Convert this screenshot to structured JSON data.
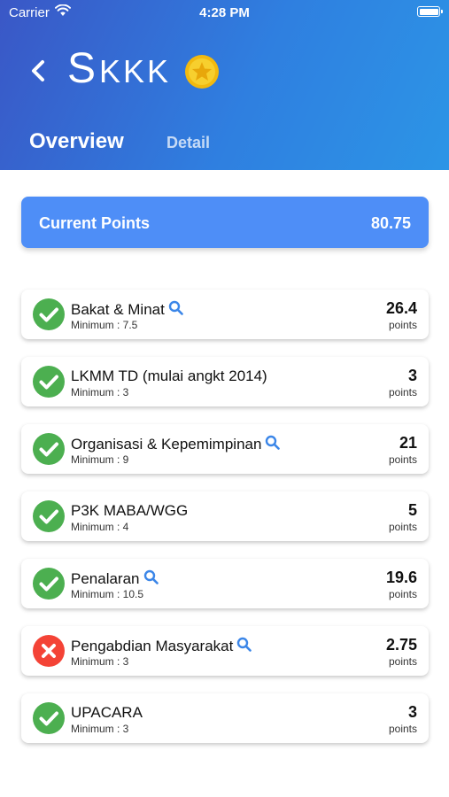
{
  "status_bar": {
    "carrier": "Carrier",
    "time": "4:28 PM"
  },
  "header": {
    "title_first": "S",
    "title_rest": "KKK",
    "tabs": [
      {
        "label": "Overview"
      },
      {
        "label": "Detail"
      }
    ]
  },
  "current_points": {
    "label": "Current Points",
    "value": "80.75"
  },
  "colors": {
    "accent": "#4e8ef7",
    "success": "#4caf50",
    "fail": "#f44336",
    "coin": "#f5c518"
  },
  "items": [
    {
      "title": "Bakat & Minat",
      "minimum": "Minimum : 7.5",
      "value": "26.4",
      "unit": "points",
      "status": "check-icon",
      "has_search": true
    },
    {
      "title": "LKMM TD (mulai angkt 2014)",
      "minimum": "Minimum : 3",
      "value": "3",
      "unit": "points",
      "status": "check-icon",
      "has_search": false
    },
    {
      "title": "Organisasi & Kepemimpinan",
      "minimum": "Minimum : 9",
      "value": "21",
      "unit": "points",
      "status": "check-icon",
      "has_search": true
    },
    {
      "title": "P3K MABA/WGG",
      "minimum": "Minimum : 4",
      "value": "5",
      "unit": "points",
      "status": "check-icon",
      "has_search": false
    },
    {
      "title": "Penalaran",
      "minimum": "Minimum : 10.5",
      "value": "19.6",
      "unit": "points",
      "status": "check-icon",
      "has_search": true
    },
    {
      "title": "Pengabdian Masyarakat",
      "minimum": "Minimum : 3",
      "value": "2.75",
      "unit": "points",
      "status": "cross-icon",
      "has_search": true
    },
    {
      "title": "UPACARA",
      "minimum": "Minimum : 3",
      "value": "3",
      "unit": "points",
      "status": "check-icon",
      "has_search": false
    }
  ]
}
